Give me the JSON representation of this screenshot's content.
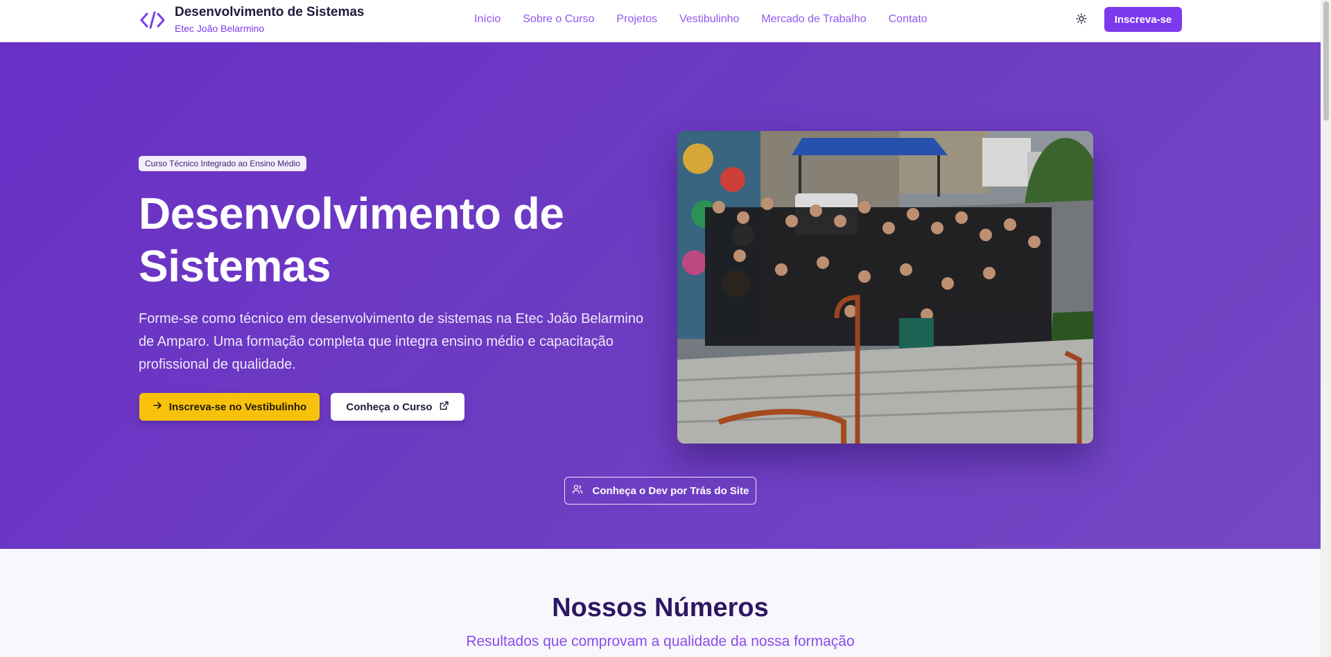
{
  "header": {
    "brand_title": "Desenvolvimento de Sistemas",
    "brand_subtitle": "Etec João Belarmino",
    "brand_icon": "code-icon",
    "nav": [
      {
        "label": "Início"
      },
      {
        "label": "Sobre o Curso"
      },
      {
        "label": "Projetos"
      },
      {
        "label": "Vestibulinho"
      },
      {
        "label": "Mercado de Trabalho"
      },
      {
        "label": "Contato"
      }
    ],
    "theme_icon": "sun-icon",
    "cta_label": "Inscreva-se"
  },
  "hero": {
    "badge": "Curso Técnico Integrado ao Ensino Médio",
    "title": "Desenvolvimento de Sistemas",
    "description": "Forme-se como técnico em desenvolvimento de sistemas na Etec João Belarmino de Amparo. Uma formação completa que integra ensino médio e capacitação profissional de qualidade.",
    "primary_button": "Inscreva-se no Vestibulinho",
    "secondary_button": "Conheça o Curso",
    "dev_button": "Conheça o Dev por Trás do Site",
    "photo_icon": "group-photo"
  },
  "stats": {
    "title": "Nossos Números",
    "subtitle": "Resultados que comprovam a qualidade da nossa formação"
  },
  "colors": {
    "accent": "#7c3aed",
    "hero_bg": "#6a30c6",
    "primary_button": "#f7c10c",
    "heading_dark": "#2b1763"
  }
}
